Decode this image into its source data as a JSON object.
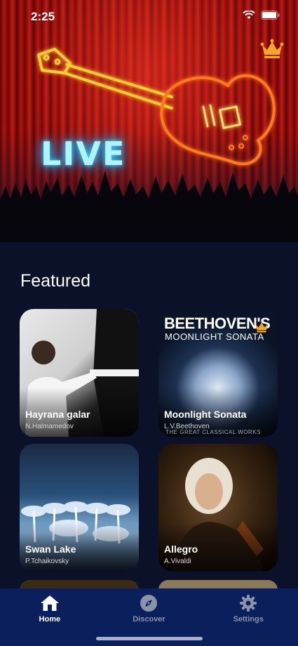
{
  "status_bar": {
    "time": "2:25"
  },
  "hero": {
    "neon_text": "LIVE"
  },
  "featured": {
    "title": "Featured",
    "cards": [
      {
        "title": "Hayrana galar",
        "artist": "N.Halmamedov"
      },
      {
        "title": "Moonlight Sonata",
        "artist": "L.V.Beethoven",
        "cover_heading": "BEETHOVEN'S",
        "cover_subheading": "MOONLIGHT SONATA",
        "cover_footer": "THE GREAT CLASSICAL WORKS"
      },
      {
        "title": "Swan Lake",
        "artist": "P.Tchaikovsky"
      },
      {
        "title": "Allegro",
        "artist": "A.Vivaldi"
      }
    ]
  },
  "tabs": [
    {
      "label": "Home",
      "icon": "home-icon",
      "active": true
    },
    {
      "label": "Discover",
      "icon": "compass-icon",
      "active": false
    },
    {
      "label": "Settings",
      "icon": "gear-icon",
      "active": false
    }
  ],
  "colors": {
    "background": "#0a1128",
    "tabbar": "#0a1f5c",
    "crown": "#f5a623",
    "neon_live": "#29d8ff",
    "neon_guitar": "#ffb020"
  }
}
